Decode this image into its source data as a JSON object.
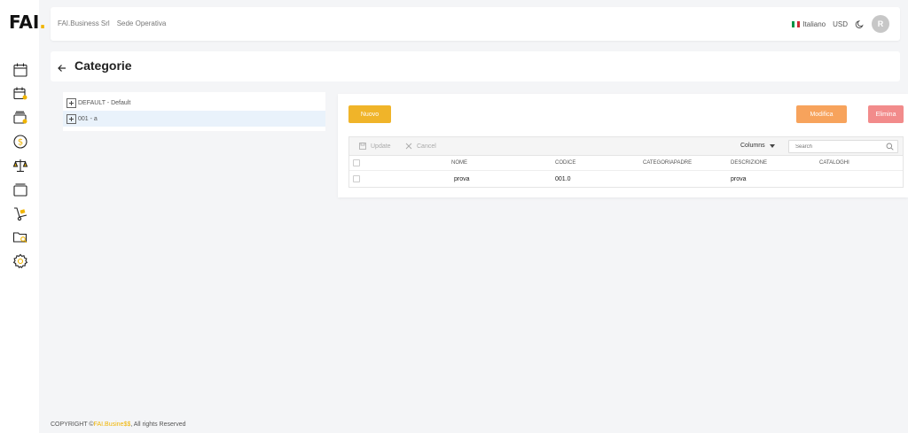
{
  "sidebar": {
    "logo": {
      "text": "FAI",
      "dot": "."
    },
    "icons": [
      "calendar-icon",
      "calendar-user-icon",
      "wallet-stack-icon",
      "dollar-coin-icon",
      "scale-icon",
      "layers-icon",
      "hand-truck-icon",
      "folder-search-icon",
      "gear-icon"
    ]
  },
  "header": {
    "company": "FAI.Business Srl",
    "sede": "Sede Operativa",
    "language": "Italiano",
    "currency": "USD",
    "avatar": "R"
  },
  "page": {
    "title": "Categorie"
  },
  "tree": {
    "nodes": [
      {
        "label": "DEFAULT - Default",
        "selected": false
      },
      {
        "label": "001 - a",
        "selected": true
      }
    ]
  },
  "actions": {
    "new": "Nuovo",
    "edit": "Modifica",
    "delete": "Elimina"
  },
  "grid": {
    "toolbar": {
      "update": "Update",
      "cancel": "Cancel",
      "columns": "Columns",
      "search_placeholder": "Search"
    },
    "columns": [
      "NOME",
      "CODICE",
      "CATEGORIAPADRE",
      "DESCRIZIONE",
      "CATALOGHI"
    ],
    "rows": [
      {
        "nome": "prova",
        "codice": "001.0",
        "categoriapadre": "",
        "descrizione": "prova",
        "cataloghi": ""
      }
    ]
  },
  "footer": {
    "prefix": "COPYRIGHT ©",
    "brand": "FAI.Busine$$",
    "suffix": ", All rights Reserved"
  },
  "colors": {
    "primary_yellow": "#f0b429",
    "edit_orange": "#f7a35c",
    "delete_red": "#f28b8b",
    "selected_row": "#e9f2fb"
  }
}
